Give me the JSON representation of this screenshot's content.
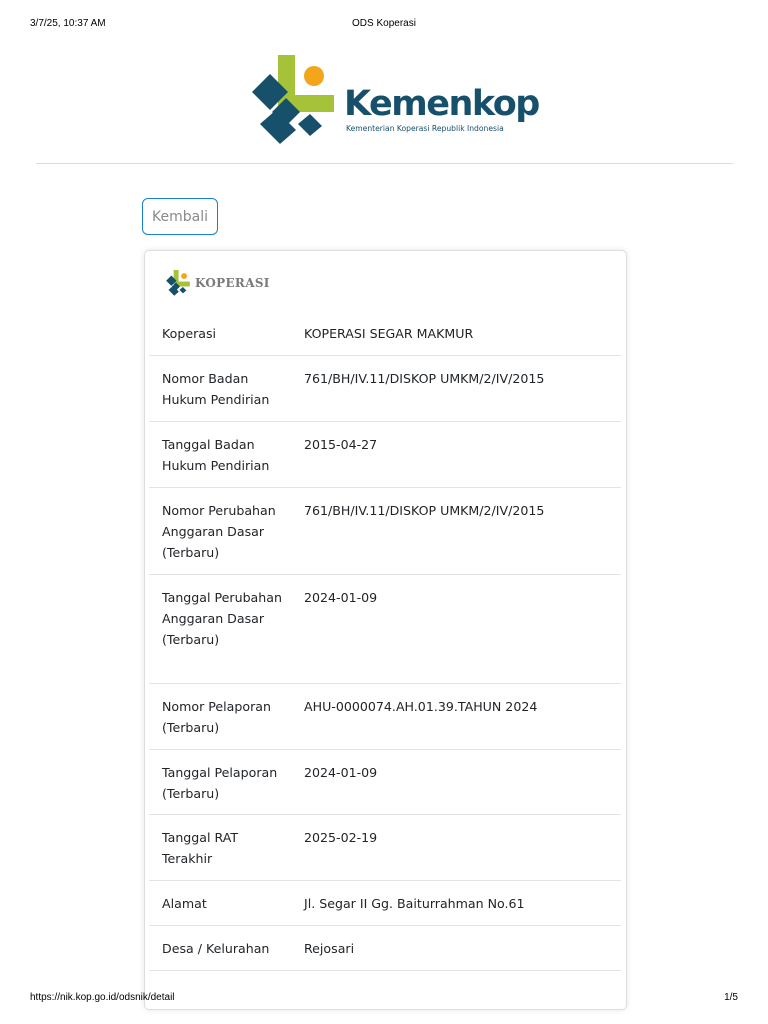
{
  "print_header": {
    "datetime": "3/7/25, 10:37 AM",
    "title": "ODS Koperasi"
  },
  "print_footer": {
    "url": "https://nik.kop.go.id/odsnik/detail",
    "page": "1/5"
  },
  "logo": {
    "name": "Kemenkop",
    "tagline": "Kementerian Koperasi Republik Indonesia",
    "colors": {
      "navy": "#17506b",
      "green": "#a6c238",
      "orange": "#f3a51b"
    }
  },
  "back_button": {
    "label": "Kembali"
  },
  "card": {
    "title": "KOPERASI",
    "rows": [
      {
        "label": "Koperasi",
        "value": "KOPERASI SEGAR MAKMUR"
      },
      {
        "label": "Nomor Badan Hukum Pendirian",
        "value": "761/BH/IV.11/DISKOP UMKM/2/IV/2015"
      },
      {
        "label": "Tanggal Badan Hukum Pendirian",
        "value": "2015-04-27"
      },
      {
        "label": "Nomor Perubahan Anggaran Dasar (Terbaru)",
        "value": "761/BH/IV.11/DISKOP UMKM/2/IV/2015"
      },
      {
        "label": "Tanggal Perubahan Anggaran Dasar (Terbaru)",
        "value": "2024-01-09"
      },
      {
        "label": "Nomor Pelaporan (Terbaru)",
        "value": "AHU-0000074.AH.01.39.TAHUN 2024"
      },
      {
        "label": "Tanggal Pelaporan (Terbaru)",
        "value": "2024-01-09"
      },
      {
        "label": "Tanggal RAT Terakhir",
        "value": "2025-02-19"
      },
      {
        "label": "Alamat",
        "value": "Jl. Segar II Gg. Baiturrahman No.61"
      },
      {
        "label": "Desa / Kelurahan",
        "value": "Rejosari"
      },
      {
        "label": "",
        "value": ""
      }
    ]
  }
}
